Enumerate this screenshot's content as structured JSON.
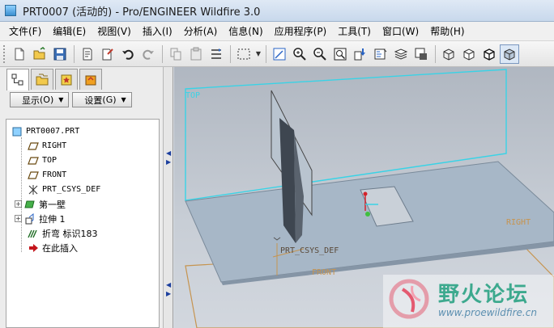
{
  "window": {
    "title": "PRT0007 (活动的) - Pro/ENGINEER Wildfire 3.0"
  },
  "menu": [
    {
      "label": "文件(F)"
    },
    {
      "label": "编辑(E)"
    },
    {
      "label": "视图(V)"
    },
    {
      "label": "插入(I)"
    },
    {
      "label": "分析(A)"
    },
    {
      "label": "信息(N)"
    },
    {
      "label": "应用程序(P)"
    },
    {
      "label": "工具(T)"
    },
    {
      "label": "窗口(W)"
    },
    {
      "label": "帮助(H)"
    }
  ],
  "toolbar": {
    "icons": [
      "new-icon",
      "open-icon",
      "save-icon",
      "print-icon",
      "regenerate-icon",
      "undo-icon",
      "redo-icon",
      "copy-icon",
      "paste-icon",
      "paste-special-icon",
      "select-box-icon",
      "repaint-icon",
      "zoom-in-icon",
      "zoom-out-icon",
      "refit-icon",
      "reorient-icon",
      "saved-views-icon",
      "layers-icon",
      "view-manager-icon",
      "wireframe-icon",
      "hidden-line-icon",
      "no-hidden-icon",
      "shading-icon"
    ]
  },
  "navigator": {
    "tabs": [
      "model-tree-icon",
      "folder-browser-icon",
      "favorites-icon",
      "connections-icon"
    ],
    "show_button": "显示",
    "show_key": "(O)",
    "settings_button": "设置",
    "settings_key": "(G)"
  },
  "tree": {
    "root": "PRT0007.PRT",
    "items": [
      {
        "label": "RIGHT",
        "icon": "datum-plane-icon",
        "expandable": false
      },
      {
        "label": "TOP",
        "icon": "datum-plane-icon",
        "expandable": false
      },
      {
        "label": "FRONT",
        "icon": "datum-plane-icon",
        "expandable": false
      },
      {
        "label": "PRT_CSYS_DEF",
        "icon": "coordinate-system-icon",
        "expandable": false
      },
      {
        "label": "第一壁",
        "icon": "sheetmetal-wall-icon",
        "expandable": true
      },
      {
        "label": "拉伸 1",
        "icon": "extrude-icon",
        "expandable": true
      },
      {
        "label": "折弯 标识183",
        "icon": "bend-icon",
        "expandable": false
      },
      {
        "label": "在此插入",
        "icon": "insert-here-arrow-icon",
        "expandable": false
      }
    ]
  },
  "viewport": {
    "labels": {
      "top": "TOP",
      "right": "RIGHT",
      "front": "FRONT",
      "csys": "PRT_CSYS_DEF"
    }
  },
  "watermark": {
    "text": "野火论坛",
    "url": "www.proewildfire.cn"
  },
  "colors": {
    "datum_cyan": "#39d3e6",
    "datum_tan": "#c69450",
    "part_fill": "#a7b7c7",
    "wall_dark": "#3e4650"
  }
}
